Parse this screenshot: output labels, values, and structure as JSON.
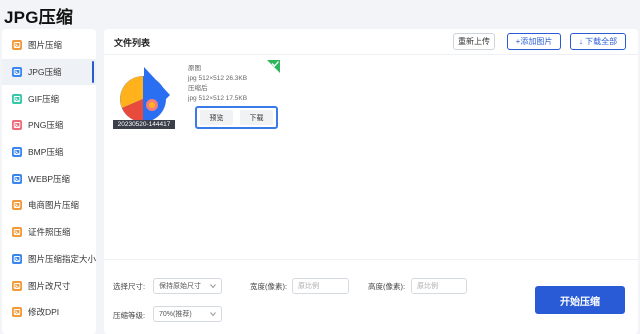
{
  "app": {
    "title": "JPG压缩"
  },
  "sidebar": {
    "items": [
      {
        "label": "图片压缩",
        "icon": "image-compress-icon",
        "color": "#f29a38"
      },
      {
        "label": "JPG压缩",
        "icon": "jpg-icon",
        "color": "#3a86f0",
        "active": true
      },
      {
        "label": "GIF压缩",
        "icon": "gif-icon",
        "color": "#35c7a8"
      },
      {
        "label": "PNG压缩",
        "icon": "png-icon",
        "color": "#f06a7a"
      },
      {
        "label": "BMP压缩",
        "icon": "bmp-icon",
        "color": "#3a86f0"
      },
      {
        "label": "WEBP压缩",
        "icon": "webp-icon",
        "color": "#3a86f0"
      },
      {
        "label": "电商图片压缩",
        "icon": "ecommerce-icon",
        "color": "#f29a38"
      },
      {
        "label": "证件照压缩",
        "icon": "id-photo-icon",
        "color": "#f29a38"
      },
      {
        "label": "图片压缩指定大小",
        "icon": "target-size-icon",
        "color": "#3a86f0"
      },
      {
        "label": "图片改尺寸",
        "icon": "resize-icon",
        "color": "#f29a38"
      },
      {
        "label": "修改DPI",
        "icon": "dpi-icon",
        "color": "#f29a38"
      }
    ]
  },
  "main": {
    "list_title": "文件列表",
    "reupload_label": "重新上传",
    "add_label": "+添加图片",
    "download_all_label": "↓ 下载全部"
  },
  "file": {
    "name": "20230520-144417",
    "original_label": "原图",
    "original_info": "jpg  512×512  26.3KB",
    "compressed_label": "压缩后",
    "compressed_info": "jpg  512×512  17.5KB",
    "preview_label": "预览",
    "download_label": "下载"
  },
  "controls": {
    "size_label": "选择尺寸:",
    "size_value": "保持原始尺寸",
    "width_label": "宽度(像素):",
    "width_placeholder": "原比例",
    "height_label": "高度(像素):",
    "height_placeholder": "原比例",
    "level_label": "压缩等级:",
    "level_value": "70%(推荐)",
    "start_label": "开始压缩"
  },
  "colors": {
    "accent": "#2a5bd7",
    "highlight_border": "#3b7ae8",
    "success": "#2fb55c"
  }
}
